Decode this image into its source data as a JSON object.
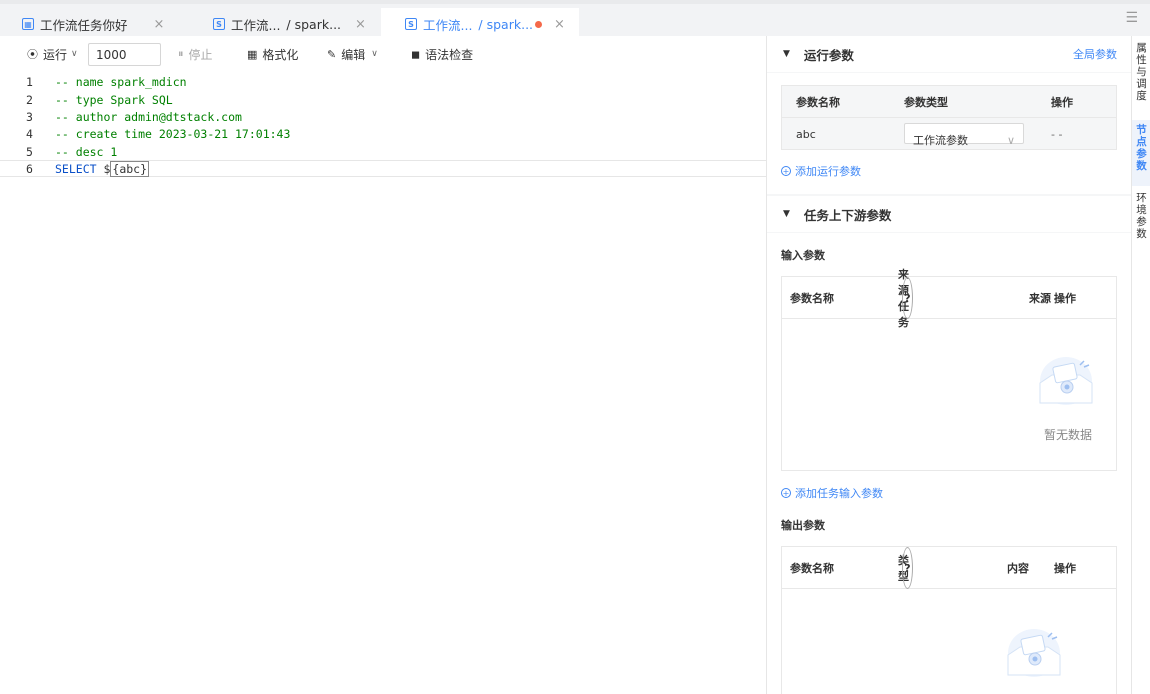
{
  "tabs": [
    {
      "icon": "sql-file-icon",
      "label": "工作流任务你好",
      "close": "×"
    },
    {
      "icon": "spark-file-icon",
      "icon_text": "S",
      "label": "工作流...",
      "sub": "/ spark...",
      "close": "×"
    },
    {
      "icon": "spark-file-icon",
      "icon_text": "S",
      "label": "工作流...",
      "sub": "/ spark...",
      "close": "×",
      "unsaved": true
    }
  ],
  "toolbar": {
    "run_label": "运行",
    "run_input_value": "1000",
    "stop_label": "停止",
    "format_label": "格式化",
    "edit_label": "编辑",
    "check_label": "语法检查"
  },
  "editor": {
    "lines": [
      {
        "n": "1",
        "text": "-- name spark_mdicn"
      },
      {
        "n": "2",
        "text": "-- type Spark SQL"
      },
      {
        "n": "3",
        "text": "-- author admin@dtstack.com"
      },
      {
        "n": "4",
        "text": "-- create time 2023-03-21 17:01:43"
      },
      {
        "n": "5",
        "text": "-- desc 1"
      },
      {
        "n": "6",
        "kw": "SELECT",
        "pre": " $",
        "var": "{abc}"
      }
    ]
  },
  "run_params": {
    "title": "运行参数",
    "global_link": "全局参数",
    "headers": [
      "参数名称",
      "参数类型",
      "操作"
    ],
    "rows": [
      {
        "name": "abc",
        "type": "工作流参数",
        "op": "- -"
      }
    ],
    "add_label": "添加运行参数"
  },
  "upstream": {
    "title": "任务上下游参数",
    "input_title": "输入参数",
    "input_headers": [
      "参数名称",
      "来源任务",
      "来源",
      "操作"
    ],
    "empty_text": "暂无数据",
    "add_input_label": "添加任务输入参数",
    "output_title": "输出参数",
    "output_headers": [
      "参数名称",
      "类型",
      "内容",
      "操作"
    ]
  },
  "side_tabs": [
    {
      "label": "属性与调度",
      "chars": [
        "属",
        "性",
        "与",
        "调",
        "度"
      ]
    },
    {
      "label": "节点参数",
      "chars": [
        "节",
        "点",
        "参",
        "数"
      ],
      "active": true
    },
    {
      "label": "环境参数",
      "chars": [
        "环",
        "境",
        "参",
        "数"
      ]
    }
  ],
  "colors": {
    "accent": "#3f87f5",
    "unsaved_dot": "#f5694a",
    "comment": "#008000"
  }
}
